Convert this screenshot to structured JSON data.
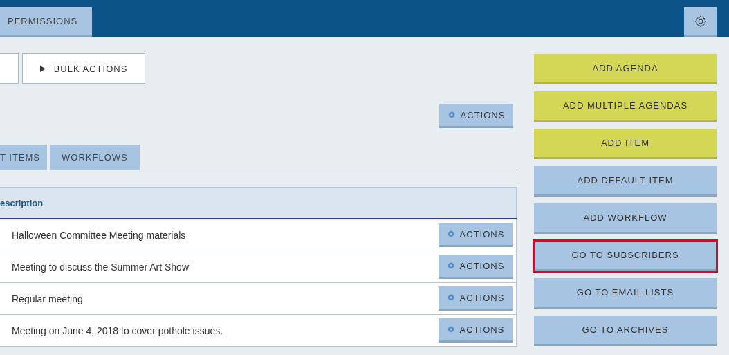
{
  "header": {
    "tabs": [
      {
        "label": "PERMISSIONS",
        "selected": false
      }
    ]
  },
  "toolbar": {
    "buttons": [
      {
        "label": "BULK ACTIONS"
      }
    ]
  },
  "actions_button": {
    "label": "ACTIONS"
  },
  "tabs": [
    {
      "label": "T ITEMS",
      "selected": false
    },
    {
      "label": "WORKFLOWS",
      "selected": false
    }
  ],
  "table": {
    "columns": [
      "escription"
    ],
    "rows": [
      {
        "description": "Halloween Committee Meeting materials",
        "action": "ACTIONS"
      },
      {
        "description": "Meeting to discuss the Summer Art Show",
        "action": "ACTIONS"
      },
      {
        "description": "Regular meeting",
        "action": "ACTIONS"
      },
      {
        "description": "Meeting on June 4, 2018 to cover pothole issues.",
        "action": "ACTIONS"
      }
    ]
  },
  "sidebar": {
    "buttons": [
      {
        "label": "ADD AGENDA",
        "kind": "primary",
        "highlighted": false
      },
      {
        "label": "ADD MULTIPLE AGENDAS",
        "kind": "primary",
        "highlighted": false
      },
      {
        "label": "ADD ITEM",
        "kind": "primary",
        "highlighted": false
      },
      {
        "label": "ADD DEFAULT ITEM",
        "kind": "secondary",
        "highlighted": false
      },
      {
        "label": "ADD WORKFLOW",
        "kind": "secondary",
        "highlighted": false
      },
      {
        "label": "GO TO SUBSCRIBERS",
        "kind": "secondary",
        "highlighted": true
      },
      {
        "label": "GO TO EMAIL LISTS",
        "kind": "secondary",
        "highlighted": false
      },
      {
        "label": "GO TO ARCHIVES",
        "kind": "secondary",
        "highlighted": false
      }
    ]
  }
}
